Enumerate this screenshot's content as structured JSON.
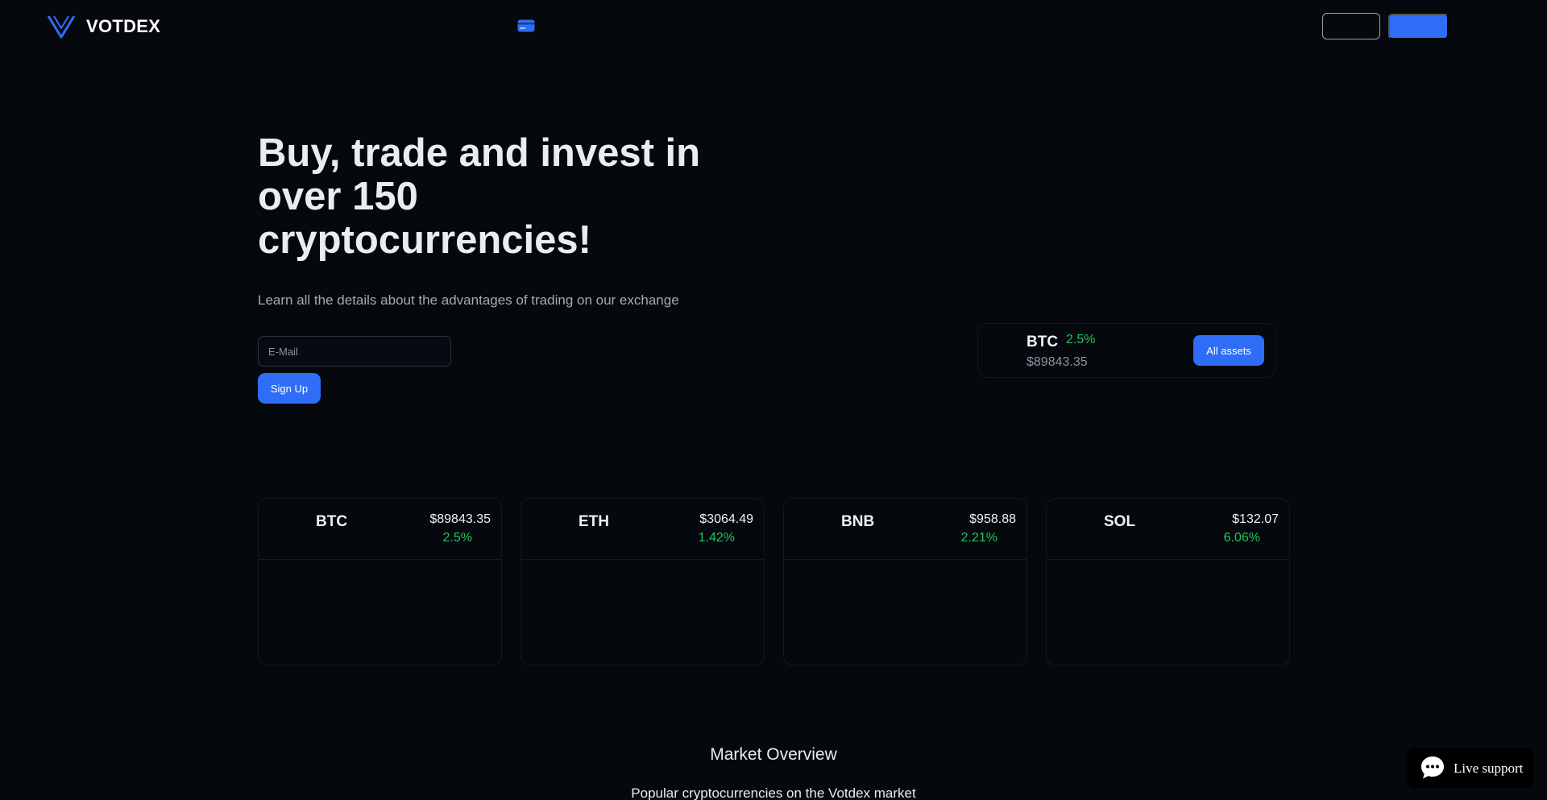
{
  "header": {
    "brand": "VOTDEX",
    "icons": {
      "logo": "votdex-v-logo",
      "card": "credit-card-icon"
    },
    "login_label": "",
    "register_label": ""
  },
  "hero": {
    "title": "Buy, trade and invest in over 150 cryptocurrencies!",
    "subtitle": "Learn all the details about the advantages of trading on our exchange",
    "email_placeholder": "E-Mail",
    "signup_label": "Sign Up"
  },
  "ticker": {
    "symbol": "BTC",
    "change": "2.5%",
    "price": "$89843.35",
    "button_label": "All assets"
  },
  "coins": [
    {
      "symbol": "BTC",
      "price": "$89843.35",
      "change": "2.5%"
    },
    {
      "symbol": "ETH",
      "price": "$3064.49",
      "change": "1.42%"
    },
    {
      "symbol": "BNB",
      "price": "$958.88",
      "change": "2.21%"
    },
    {
      "symbol": "SOL",
      "price": "$132.07",
      "change": "6.06%"
    }
  ],
  "market": {
    "title": "Market Overview",
    "subtitle": "Popular cryptocurrencies on the Votdex market"
  },
  "support": {
    "label": "Live support",
    "icon": "chat-bubble-icon"
  },
  "colors": {
    "background": "#05080d",
    "accent": "#2f6df6",
    "positive": "#22c55e",
    "muted": "#8b929e"
  }
}
